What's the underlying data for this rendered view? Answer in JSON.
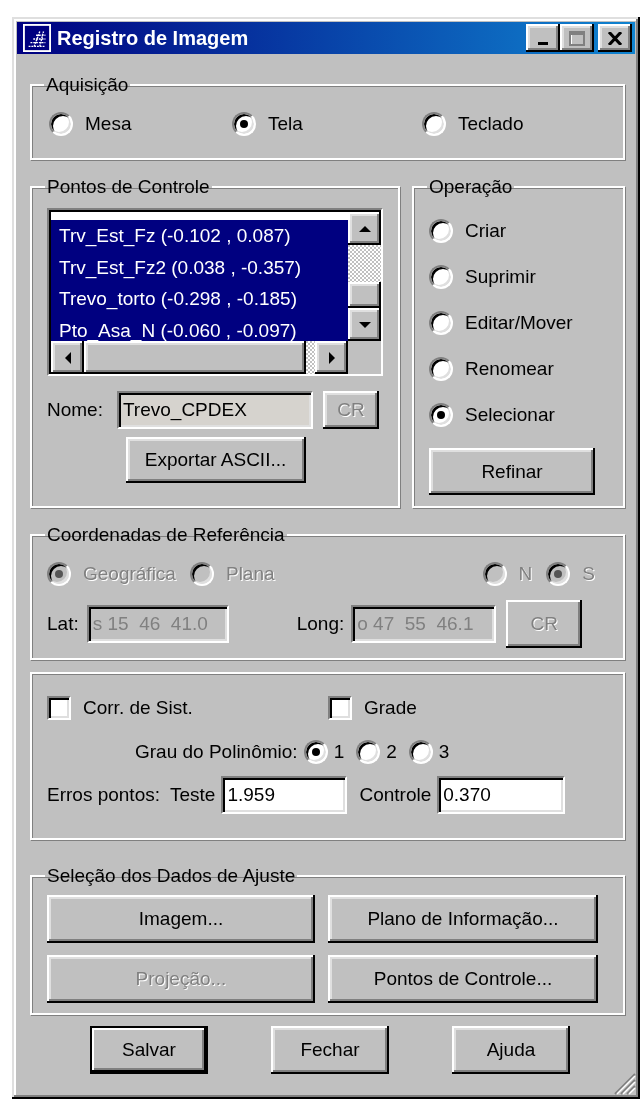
{
  "window": {
    "title": "Registro de Imagem",
    "controls": [
      {
        "kind": "minimize",
        "disabled": false
      },
      {
        "kind": "maximize",
        "disabled": true
      },
      {
        "kind": "close",
        "disabled": false
      }
    ]
  },
  "acquisition": {
    "title": "Aquisição",
    "options": [
      {
        "label": "Mesa",
        "selected": false
      },
      {
        "label": "Tela",
        "selected": true
      },
      {
        "label": "Teclado",
        "selected": false
      }
    ]
  },
  "control_points": {
    "title": "Pontos de Controle",
    "items": [
      {
        "label": "Trv_Est_Fz (-0.102 , 0.087)",
        "selected": true
      },
      {
        "label": "Trv_Est_Fz2 (0.038 , -0.357)",
        "selected": true
      },
      {
        "label": "Trevo_torto (-0.298 , -0.185)",
        "selected": true
      },
      {
        "label": "Pto_Asa_N (-0.060 , -0.097)",
        "selected": true
      }
    ],
    "name_label": "Nome:",
    "name_value": "Trevo_CPDEX",
    "cr_button": {
      "label": "CR",
      "disabled": true
    },
    "export_button": "Exportar ASCII..."
  },
  "operation": {
    "title": "Operação",
    "options": [
      {
        "label": "Criar",
        "selected": false
      },
      {
        "label": "Suprimir",
        "selected": false
      },
      {
        "label": "Editar/Mover",
        "selected": false
      },
      {
        "label": "Renomear",
        "selected": false
      },
      {
        "label": "Selecionar",
        "selected": true
      }
    ],
    "refine_button": {
      "label": "Refinar"
    }
  },
  "reference": {
    "title": "Coordenadas de Referência",
    "disabled": true,
    "systems": [
      {
        "label": "Geográfica",
        "selected": true
      },
      {
        "label": "Plana",
        "selected": false
      }
    ],
    "hemispheres": [
      {
        "label": "N",
        "selected": false
      },
      {
        "label": "S",
        "selected": true
      }
    ],
    "lat": {
      "label": "Lat:",
      "value": "s 15  46  41.0"
    },
    "long": {
      "label": "Long:",
      "value": "o 47  55  46.1"
    },
    "cr_button": {
      "label": "CR",
      "disabled": true
    }
  },
  "options": {
    "checkboxes": [
      {
        "label": "Corr. de Sist.",
        "checked": false
      },
      {
        "label": "Grade",
        "checked": false
      }
    ],
    "degree_label": "Grau do Polinômio:",
    "degrees": [
      {
        "label": "1",
        "selected": true
      },
      {
        "label": "2",
        "selected": false
      },
      {
        "label": "3",
        "selected": false
      }
    ],
    "errors_label": "Erros pontos:",
    "test": {
      "label": "Teste",
      "value": "1.959"
    },
    "control": {
      "label": "Controle",
      "value": "0.370"
    }
  },
  "selection": {
    "title": "Seleção dos Dados de Ajuste",
    "buttons": [
      {
        "label": "Imagem...",
        "disabled": false
      },
      {
        "label": "Plano de Informação...",
        "disabled": false
      },
      {
        "label": "Projeção...",
        "disabled": true
      },
      {
        "label": "Pontos de Controle...",
        "disabled": false
      }
    ]
  },
  "footer_buttons": [
    {
      "label": "Salvar",
      "default": true
    },
    {
      "label": "Fechar",
      "default": false
    },
    {
      "label": "Ajuda",
      "default": false
    }
  ]
}
